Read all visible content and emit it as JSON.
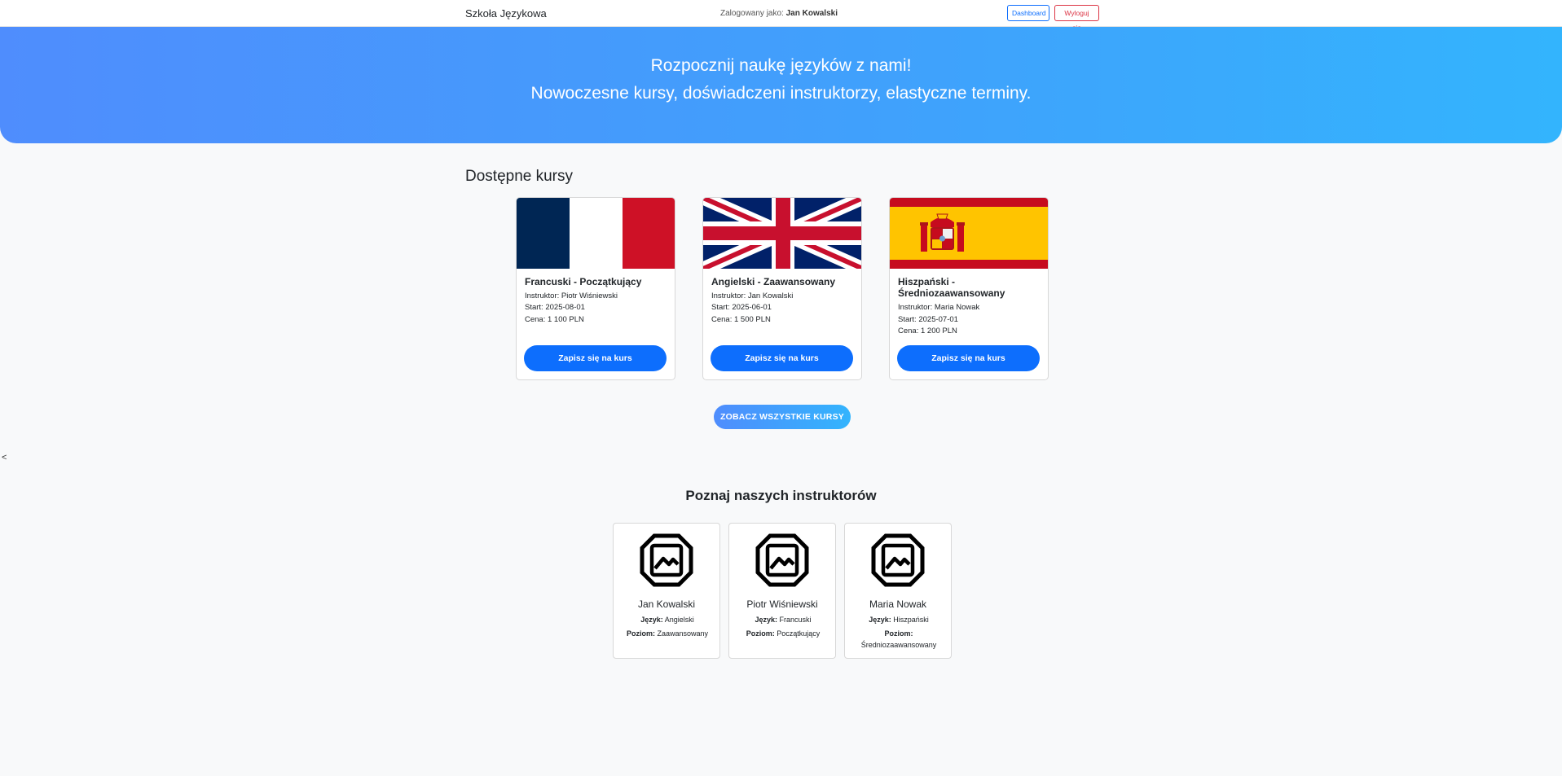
{
  "navbar": {
    "brand": "Szkoła Językowa",
    "logged_prefix": "Zalogowany jako:",
    "logged_user": "Jan Kowalski",
    "dashboard_label": "Dashboard",
    "logout_label": "Wyloguj się"
  },
  "hero": {
    "line1": "Rozpocznij naukę języków z nami!",
    "line2": "Nowoczesne kursy, doświadczeni instruktorzy, elastyczne terminy."
  },
  "courses": {
    "section_title": "Dostępne kursy",
    "items": [
      {
        "title": "Francuski - Początkujący",
        "instructor": "Instruktor: Piotr Wiśniewski",
        "start": "Start: 2025-08-01",
        "price": "Cena: 1 100 PLN",
        "button": "Zapisz się na kurs",
        "flag": "flag-france-icon"
      },
      {
        "title": "Angielski - Zaawansowany",
        "instructor": "Instruktor: Jan Kowalski",
        "start": "Start: 2025-06-01",
        "price": "Cena: 1 500 PLN",
        "button": "Zapisz się na kurs",
        "flag": "flag-uk-icon"
      },
      {
        "title": "Hiszpański - Średniozaawansowany",
        "instructor": "Instruktor: Maria Nowak",
        "start": "Start: 2025-07-01",
        "price": "Cena: 1 200 PLN",
        "button": "Zapisz się na kurs",
        "flag": "flag-spain-icon"
      }
    ],
    "see_all_label": "ZOBACZ WSZYSTKIE KURSY"
  },
  "stray_char": "<",
  "instructors": {
    "section_title": "Poznaj naszych instruktorów",
    "language_label": "Język:",
    "level_label": "Poziom:",
    "items": [
      {
        "name": "Jan Kowalski",
        "language": "Angielski",
        "level": "Zaawansowany",
        "icon": "image-placeholder-icon"
      },
      {
        "name": "Piotr Wiśniewski",
        "language": "Francuski",
        "level": "Początkujący",
        "icon": "image-placeholder-icon"
      },
      {
        "name": "Maria Nowak",
        "language": "Hiszpański",
        "level": "Średniozaawansowany",
        "icon": "image-placeholder-icon"
      }
    ]
  },
  "colors": {
    "primary": "#0d6efd",
    "danger": "#dc3545",
    "hero_start": "#4f8dfd",
    "hero_end": "#33b4fd",
    "background": "#f8f9fa"
  }
}
